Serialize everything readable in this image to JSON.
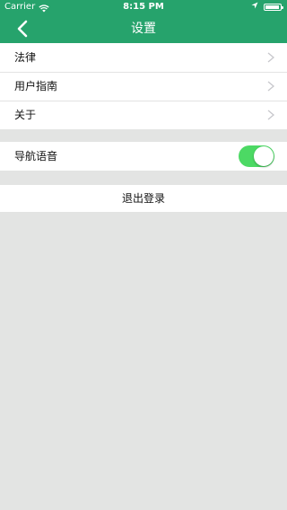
{
  "status_bar": {
    "carrier": "Carrier",
    "time": "8:15 PM"
  },
  "nav": {
    "title": "设置",
    "back_icon": "chevron-left-icon"
  },
  "menu": [
    {
      "label": "法律",
      "icon": "chevron-right-icon"
    },
    {
      "label": "用户指南",
      "icon": "chevron-right-icon"
    },
    {
      "label": "关于",
      "icon": "chevron-right-icon"
    }
  ],
  "settings": {
    "nav_voice_label": "导航语音",
    "nav_voice_on": true
  },
  "logout_label": "退出登录",
  "colors": {
    "header_bg": "#26a36c",
    "background": "#e3e4e3",
    "toggle_on": "#4cd964",
    "chevron": "#c7c7cc"
  }
}
